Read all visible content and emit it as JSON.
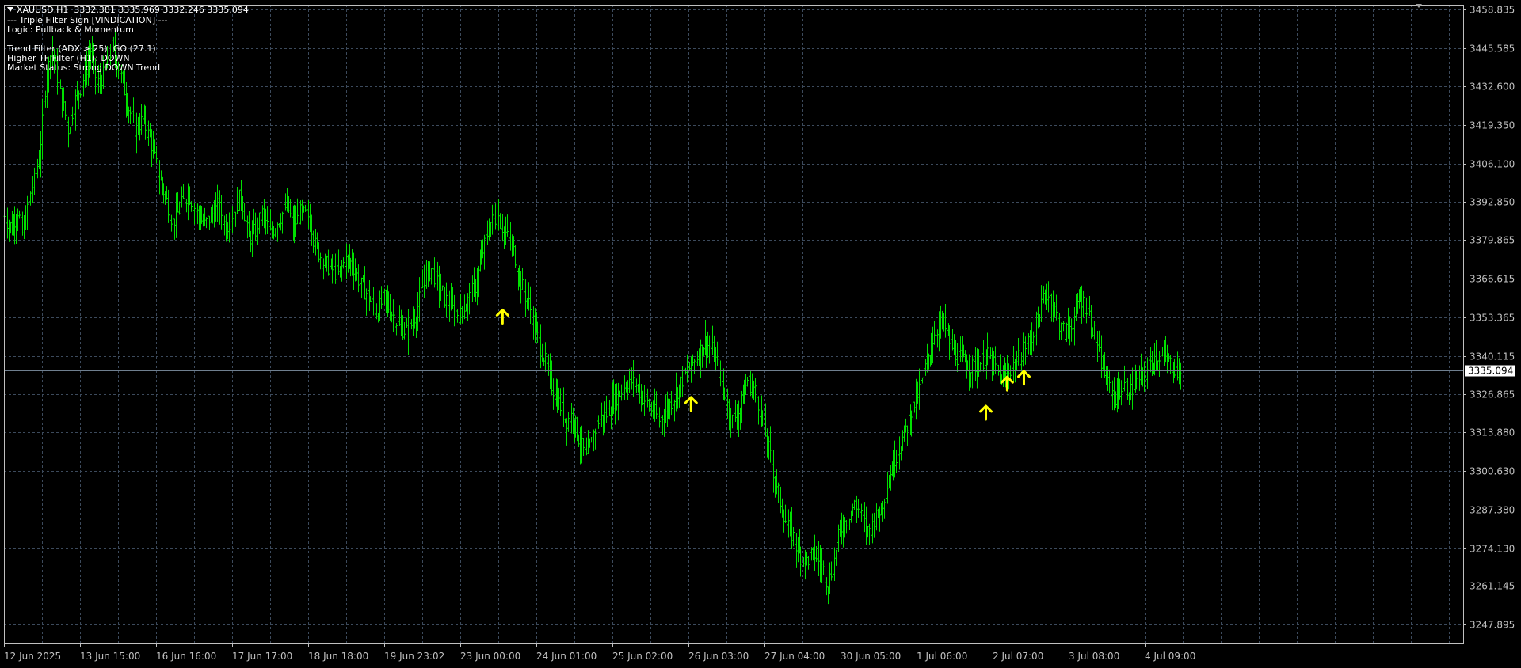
{
  "header": {
    "symbol": "XAUUSD,H1",
    "ohlc": "3332.381 3335.969 3332.246 3335.094"
  },
  "indicator": {
    "lines": [
      "--- Triple Filter Sign [VINDICATION] ---",
      "Logic: Pullback & Momentum",
      "",
      "Trend Filter (ADX > 25): GO (27.1)",
      "Higher TF Filter (H1): DOWN",
      "Market Status: Strong DOWN Trend"
    ]
  },
  "colors": {
    "background": "#000000",
    "grid": "#3c4a5c",
    "axis": "#c0c0c0",
    "candle": "#00e000",
    "arrow": "#ffff00",
    "price_line": "#6f7f8f",
    "label_bg": "#ffffff"
  },
  "chart_data": {
    "type": "candlestick",
    "symbol": "XAUUSD",
    "timeframe": "H1",
    "current_price": 3335.094,
    "current_price_label": "3335.094",
    "ylim": [
      3241.4,
      3460.6
    ],
    "y_ticks": [
      "3458.835",
      "3445.585",
      "3432.600",
      "3419.350",
      "3406.100",
      "3392.850",
      "3379.865",
      "3366.615",
      "3353.365",
      "3340.115",
      "3326.865",
      "3313.880",
      "3300.630",
      "3287.380",
      "3274.130",
      "3261.145",
      "3247.895"
    ],
    "x_tick_labels": [
      "12 Jun 2025",
      "13 Jun 15:00",
      "16 Jun 16:00",
      "17 Jun 17:00",
      "18 Jun 18:00",
      "19 Jun 23:02",
      "23 Jun 00:00",
      "24 Jun 01:00",
      "25 Jun 02:00",
      "26 Jun 03:00",
      "27 Jun 04:00",
      "30 Jun 05:00",
      "1 Jul 06:00",
      "2 Jul 07:00",
      "3 Jul 08:00",
      "4 Jul 09:00"
    ],
    "path_points": [
      [
        0,
        3388
      ],
      [
        5,
        3384
      ],
      [
        9,
        3390
      ],
      [
        12,
        3382
      ],
      [
        17,
        3395
      ],
      [
        20,
        3400
      ],
      [
        23,
        3408
      ],
      [
        28,
        3438
      ],
      [
        32,
        3445
      ],
      [
        37,
        3430
      ],
      [
        42,
        3418
      ],
      [
        47,
        3428
      ],
      [
        52,
        3435
      ],
      [
        57,
        3445
      ],
      [
        61,
        3433
      ],
      [
        66,
        3437
      ],
      [
        71,
        3446
      ],
      [
        76,
        3438
      ],
      [
        81,
        3427
      ],
      [
        86,
        3418
      ],
      [
        91,
        3421
      ],
      [
        96,
        3415
      ],
      [
        101,
        3403
      ],
      [
        106,
        3395
      ],
      [
        111,
        3386
      ],
      [
        116,
        3391
      ],
      [
        121,
        3396
      ],
      [
        126,
        3390
      ],
      [
        132,
        3385
      ],
      [
        136,
        3388
      ],
      [
        141,
        3392
      ],
      [
        146,
        3384
      ],
      [
        151,
        3390
      ],
      [
        156,
        3395
      ],
      [
        161,
        3380
      ],
      [
        166,
        3384
      ],
      [
        170,
        3389
      ],
      [
        175,
        3382
      ],
      [
        181,
        3387
      ],
      [
        186,
        3392
      ],
      [
        190,
        3384
      ],
      [
        195,
        3389
      ],
      [
        200,
        3388
      ],
      [
        205,
        3378
      ],
      [
        210,
        3372
      ],
      [
        215,
        3370
      ],
      [
        220,
        3368
      ],
      [
        224,
        3373
      ],
      [
        229,
        3372
      ],
      [
        234,
        3365
      ],
      [
        240,
        3360
      ],
      [
        245,
        3355
      ],
      [
        250,
        3360
      ],
      [
        255,
        3355
      ],
      [
        260,
        3350
      ],
      [
        266,
        3348
      ],
      [
        271,
        3355
      ],
      [
        276,
        3366
      ],
      [
        281,
        3370
      ],
      [
        285,
        3365
      ],
      [
        290,
        3360
      ],
      [
        295,
        3356
      ],
      [
        300,
        3354
      ],
      [
        305,
        3359
      ],
      [
        310,
        3364
      ],
      [
        315,
        3376
      ],
      [
        320,
        3386
      ],
      [
        325,
        3388
      ],
      [
        330,
        3382
      ],
      [
        335,
        3376
      ],
      [
        340,
        3365
      ],
      [
        345,
        3358
      ],
      [
        350,
        3348
      ],
      [
        355,
        3340
      ],
      [
        360,
        3330
      ],
      [
        365,
        3324
      ],
      [
        370,
        3318
      ],
      [
        374,
        3320
      ],
      [
        379,
        3310
      ],
      [
        383,
        3305
      ],
      [
        387,
        3312
      ],
      [
        391,
        3318
      ],
      [
        396,
        3320
      ],
      [
        401,
        3325
      ],
      [
        406,
        3328
      ],
      [
        411,
        3332
      ],
      [
        416,
        3330
      ],
      [
        421,
        3325
      ],
      [
        426,
        3322
      ],
      [
        431,
        3318
      ],
      [
        436,
        3322
      ],
      [
        441,
        3326
      ],
      [
        446,
        3332
      ],
      [
        451,
        3336
      ],
      [
        456,
        3340
      ],
      [
        461,
        3345
      ],
      [
        466,
        3342
      ],
      [
        470,
        3335
      ],
      [
        475,
        3325
      ],
      [
        479,
        3318
      ],
      [
        484,
        3322
      ],
      [
        489,
        3332
      ],
      [
        494,
        3328
      ],
      [
        499,
        3318
      ],
      [
        503,
        3308
      ],
      [
        507,
        3298
      ],
      [
        511,
        3290
      ],
      [
        515,
        3282
      ],
      [
        519,
        3278
      ],
      [
        523,
        3272
      ],
      [
        528,
        3270
      ],
      [
        533,
        3272
      ],
      [
        538,
        3268
      ],
      [
        542,
        3262
      ],
      [
        546,
        3270
      ],
      [
        550,
        3280
      ],
      [
        555,
        3285
      ],
      [
        560,
        3290
      ],
      [
        564,
        3285
      ],
      [
        568,
        3280
      ],
      [
        573,
        3283
      ],
      [
        578,
        3290
      ],
      [
        582,
        3298
      ],
      [
        586,
        3305
      ],
      [
        590,
        3310
      ],
      [
        595,
        3318
      ],
      [
        600,
        3325
      ],
      [
        604,
        3332
      ],
      [
        608,
        3340
      ],
      [
        612,
        3348
      ],
      [
        617,
        3352
      ],
      [
        622,
        3345
      ],
      [
        627,
        3340
      ],
      [
        632,
        3338
      ],
      [
        637,
        3336
      ],
      [
        642,
        3338
      ],
      [
        647,
        3340
      ],
      [
        652,
        3336
      ],
      [
        656,
        3332
      ],
      [
        661,
        3335
      ],
      [
        666,
        3338
      ],
      [
        671,
        3343
      ],
      [
        676,
        3346
      ],
      [
        681,
        3355
      ],
      [
        685,
        3362
      ],
      [
        689,
        3360
      ],
      [
        693,
        3352
      ],
      [
        698,
        3348
      ],
      [
        703,
        3352
      ],
      [
        708,
        3360
      ],
      [
        713,
        3356
      ],
      [
        717,
        3348
      ],
      [
        722,
        3338
      ],
      [
        726,
        3330
      ],
      [
        731,
        3326
      ],
      [
        736,
        3330
      ],
      [
        741,
        3328
      ],
      [
        746,
        3332
      ],
      [
        751,
        3334
      ],
      [
        756,
        3340
      ],
      [
        761,
        3340
      ],
      [
        766,
        3338
      ],
      [
        771,
        3335
      ],
      [
        774,
        3334
      ]
    ],
    "signals": [
      {
        "type": "buy-arrow",
        "x": 328,
        "y": 3354
      },
      {
        "type": "buy-arrow",
        "x": 452,
        "y": 3324
      },
      {
        "type": "buy-arrow",
        "x": 646,
        "y": 3321
      },
      {
        "type": "buy-arrow",
        "x": 660,
        "y": 3331
      },
      {
        "type": "buy-arrow",
        "x": 671,
        "y": 3333
      }
    ],
    "xlim": [
      0,
      960
    ],
    "grid": true
  }
}
